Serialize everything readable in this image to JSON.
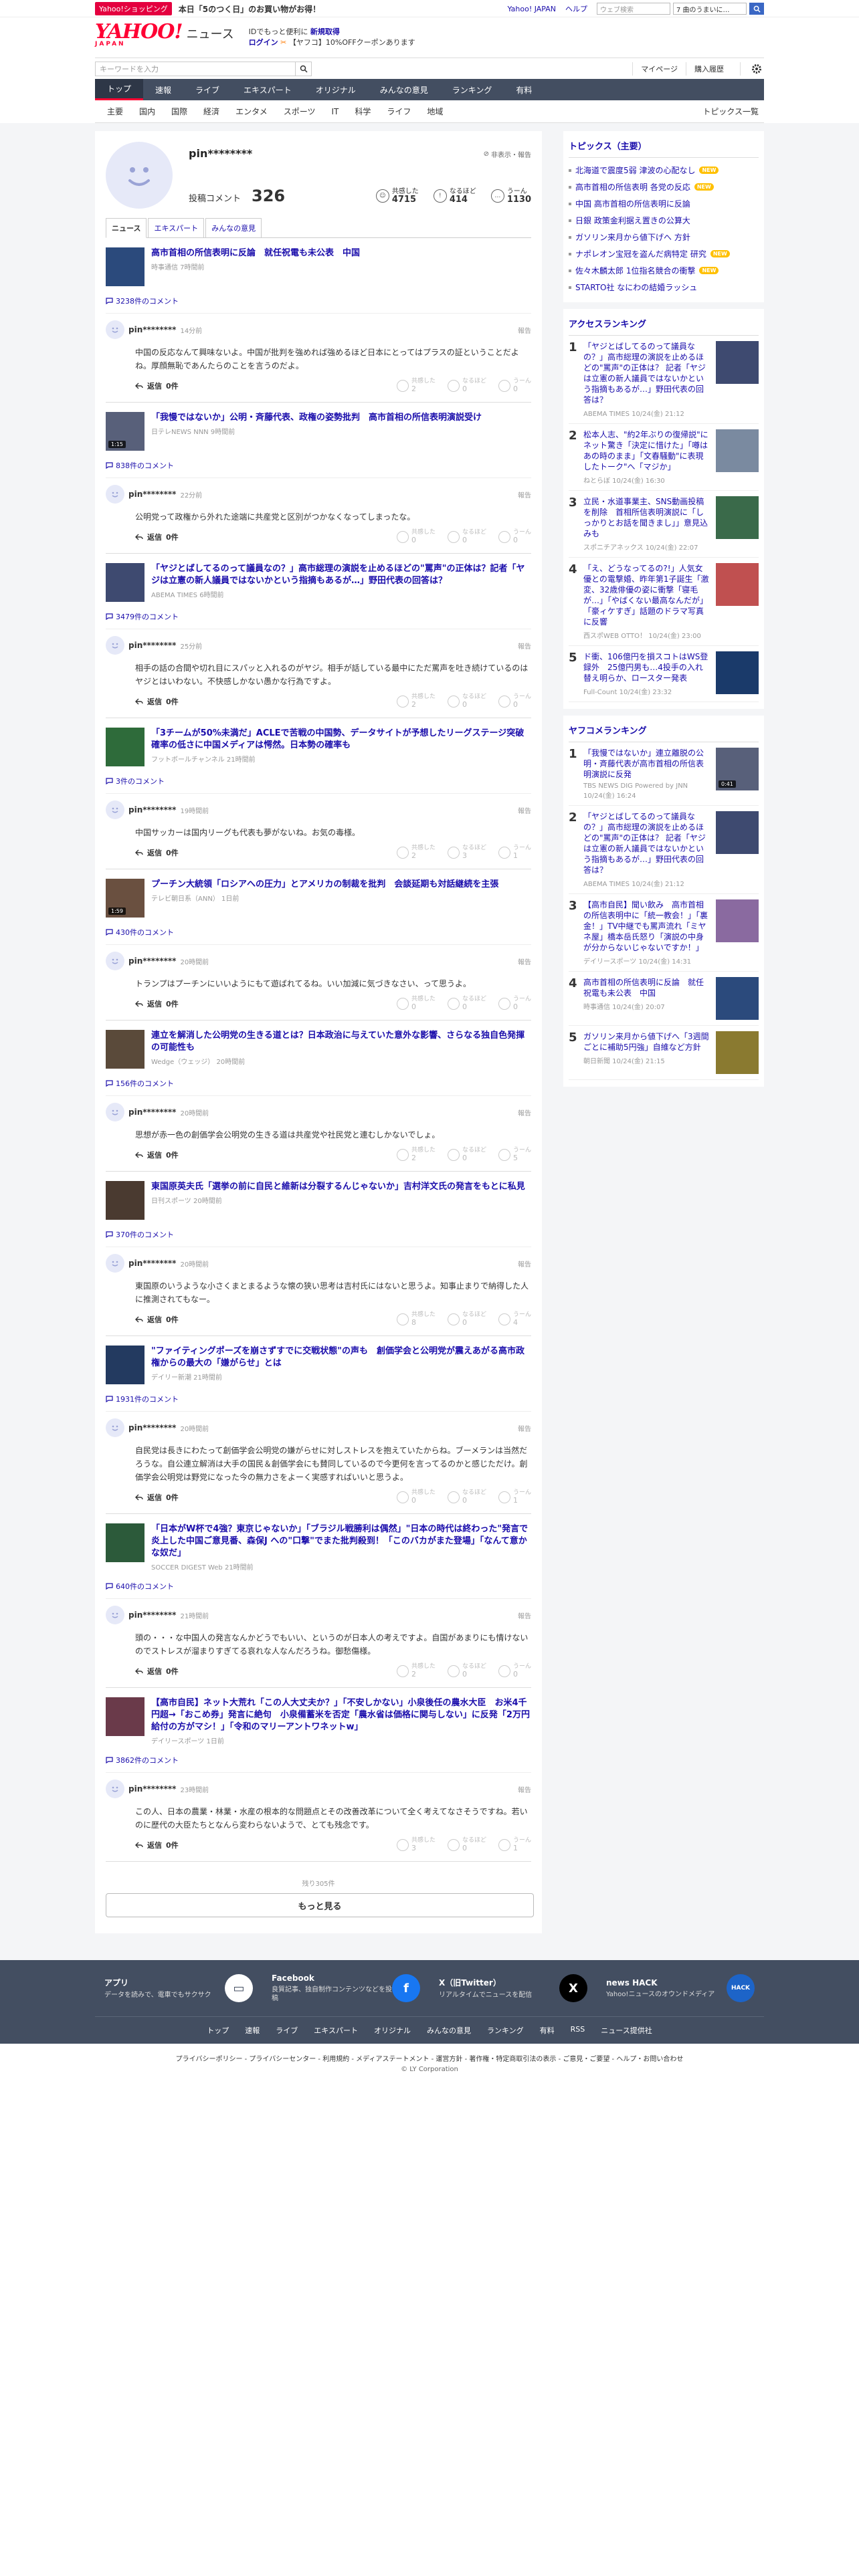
{
  "promo": {
    "tag": "Yahoo!ショッピング",
    "text": "本日「5のつく日」のお買い物がお得！",
    "links": [
      "Yahoo! JAPAN",
      "ヘルプ"
    ],
    "search_placeholder": "ウェブ検索",
    "search_value": "7 曲のうまいに…"
  },
  "header": {
    "logo": "YAHOO!",
    "logo_sub": "JAPAN",
    "section": "ニュース",
    "pr_line1": "IDでもっと便利に",
    "pr_line1_link": "新規取得",
    "pr_login": "ログイン",
    "pr_line2_text": "【ヤフコ】10%OFFクーポンあります"
  },
  "search": {
    "placeholder": "キーワードを入力",
    "mypage": "マイページ",
    "purchased": "購入履歴"
  },
  "main_nav": [
    "トップ",
    "速報",
    "ライブ",
    "エキスパート",
    "オリジナル",
    "みんなの意見",
    "ランキング",
    "有料"
  ],
  "sub_nav": [
    "主要",
    "国内",
    "国際",
    "経済",
    "エンタメ",
    "スポーツ",
    "IT",
    "科学",
    "ライフ",
    "地域"
  ],
  "sub_nav_right": "トピックス一覧",
  "profile": {
    "username": "pin********",
    "hide_report": "非表示・報告",
    "comment_label": "投稿コメント",
    "comment_count": "326",
    "empathy_label": "共感した",
    "empathy_count": "4715",
    "naruhodo_label": "なるほど",
    "naruhodo_count": "414",
    "uun_label": "うーん",
    "uun_count": "1130"
  },
  "tabs": [
    "ニュース",
    "エキスパート",
    "みんなの意見"
  ],
  "reaction_labels": [
    "共感した",
    "なるほど",
    "うーん"
  ],
  "reply_label": "返信",
  "report_label": "報告",
  "entries": [
    {
      "title": "高市首相の所信表明に反論　就任祝電も未公表　中国",
      "source": "時事通信 7時間前",
      "comment_count": "3238件のコメント",
      "user": "pin********",
      "time": "14分前",
      "text": "中国の反応なんて興味ないよ。中国が批判を強めれば強めるほど日本にとってはプラスの証ということだよね。厚顔無恥であんたらのことを言うのだよ。",
      "replies": "0件",
      "reactions": [
        "2",
        "0",
        "0"
      ],
      "thumb_color": "#2b4a7c"
    },
    {
      "title": "「我慢ではないか」公明・斉藤代表、政権の姿勢批判　高市首相の所信表明演説受け",
      "source": "日テレNEWS NNN 9時間前",
      "comment_count": "838件のコメント",
      "user": "pin********",
      "time": "22分前",
      "text": "公明党って政権から外れた途端に共産党と区別がつかなくなってしまったな。",
      "replies": "0件",
      "reactions": [
        "0",
        "0",
        "0"
      ],
      "thumb_color": "#58607a",
      "video": "1:15"
    },
    {
      "title": "「ヤジとばしてるのって議員なの？」高市総理の演説を止めるほどの\"罵声\"の正体は？記者「ヤジは立憲の新人議員ではないかという指摘もあるが…」野田代表の回答は？",
      "source": "ABEMA TIMES 6時間前",
      "comment_count": "3479件のコメント",
      "user": "pin********",
      "time": "25分前",
      "text": "相手の話の合間や切れ目にスパッと入れるのがヤジ。相手が話している最中にただ罵声を吐き続けているのはヤジとはいわない。不快感しかない愚かな行為ですよ。",
      "replies": "0件",
      "reactions": [
        "2",
        "0",
        "0"
      ],
      "thumb_color": "#3e4a70"
    },
    {
      "title": "「3チームが50%未満だ」ACLEで苦戦の中国勢、データサイトが予想したリーグステージ突破確率の低さに中国メディアは愕然。日本勢の確率も",
      "source": "フットボールチャンネル 21時間前",
      "comment_count": "3件のコメント",
      "user": "pin********",
      "time": "19時間前",
      "text": "中国サッカーは国内リーグも代表も夢がないね。お気の毒様。",
      "replies": "0件",
      "reactions": [
        "2",
        "3",
        "1"
      ],
      "thumb_color": "#2e6b3a"
    },
    {
      "title": "プーチン大統領「ロシアへの圧力」とアメリカの制裁を批判　会談延期も対話継続を主張",
      "source": "テレビ朝日系（ANN） 1日前",
      "comment_count": "430件のコメント",
      "user": "pin********",
      "time": "20時間前",
      "text": "トランプはプーチンにいいようにもて遊ばれてるね。いい加減に気づきなさい、って思うよ。",
      "replies": "0件",
      "reactions": [
        "0",
        "0",
        "0"
      ],
      "thumb_color": "#6a5040",
      "video": "1:59"
    },
    {
      "title": "連立を解消した公明党の生きる道とは？日本政治に与えていた意外な影響、さらなる独自色発揮の可能性も",
      "source": "Wedge（ウェッジ） 20時間前",
      "comment_count": "156件のコメント",
      "user": "pin********",
      "time": "20時間前",
      "text": "思想が赤一色の創価学会公明党の生きる道は共産党や社民党と連むしかないでしょ。",
      "replies": "0件",
      "reactions": [
        "2",
        "0",
        "5"
      ],
      "thumb_color": "#5a4a3a"
    },
    {
      "title": "東国原英夫氏「選挙の前に自民と維新は分裂するんじゃないか」吉村洋文氏の発言をもとに私見",
      "source": "日刊スポーツ 20時間前",
      "comment_count": "370件のコメント",
      "user": "pin********",
      "time": "20時間前",
      "text": "東国原のいうような小さくまとまるような懐の狭い思考は吉村氏にはないと思うよ。知事止まりで納得した人に推測されてもなー。",
      "replies": "0件",
      "reactions": [
        "8",
        "0",
        "4"
      ],
      "thumb_color": "#4a3a30"
    },
    {
      "title": "\"ファイティングポーズを崩さずすでに交戦状態\"の声も　創価学会と公明党が震えあがる高市政権からの最大の「嫌がらせ」とは",
      "source": "デイリー新潮 21時間前",
      "comment_count": "1931件のコメント",
      "user": "pin********",
      "time": "20時間前",
      "text": "自民党は長きにわたって創価学会公明党の嫌がらせに対しストレスを抱えていたからね。ブーメランは当然だろうな。自公連立解消は大手の国民＆創価学会にも賛同しているので今更何を言ってるのかと感じただけ。創価学会公明党は野党になった今の無力さをよーく実感すればいいと思うよ。",
      "replies": "0件",
      "reactions": [
        "0",
        "0",
        "1"
      ],
      "thumb_color": "#233a60"
    },
    {
      "title": "「日本がW杯で4強？東京じゃないか」「ブラジル戦勝利は偶然」\"日本の時代は終わった\"発言で炎上した中国ご意見番、森保J への\"口撃\"でまた批判殺到！「このバカがまた登場」「なんて意かな奴だ」",
      "source": "SOCCER DIGEST Web 21時間前",
      "comment_count": "640件のコメント",
      "user": "pin********",
      "time": "21時間前",
      "text": "頭の・・・な中国人の発言なんかどうでもいい、というのが日本人の考えですよ。自国があまりにも情けないのでストレスが溜まりすぎてる哀れな人なんだろうね。御愁傷様。",
      "replies": "0件",
      "reactions": [
        "2",
        "0",
        "0"
      ],
      "thumb_color": "#2c5a3a"
    },
    {
      "title": "【高市自民】ネット大荒れ「この人大丈夫か？」「不安しかない」小泉後任の農水大臣　お米4千円超→「おこめ券」発言に絶句　小泉備蓄米を否定「農水省は価格に関与しない」に反発「2万円給付の方がマシ！」「令和のマリーアントワネットw」",
      "source": "デイリースポーツ 1日前",
      "comment_count": "3862件のコメント",
      "user": "pin********",
      "time": "23時間前",
      "text": "この人、日本の農業・林業・水産の根本的な問題点とその改善改革について全く考えてなさそうですね。若いのに歴代の大臣たちとなんら変わらないようで、とても残念です。",
      "replies": "0件",
      "reactions": [
        "3",
        "0",
        "1"
      ],
      "thumb_color": "#6a3a4a"
    }
  ],
  "remaining": "残り305件",
  "more_button": "もっと見る",
  "sidebar": {
    "topics_header": "トピックス（主要）",
    "topics": [
      {
        "text": "北海道で震度5弱 津波の心配なし",
        "badge": "NEW"
      },
      {
        "text": "高市首相の所信表明 各党の反応",
        "badge": "NEW"
      },
      {
        "text": "中国 高市首相の所信表明に反論",
        "badge": ""
      },
      {
        "text": "日銀 政策金利据え置きの公算大",
        "badge": ""
      },
      {
        "text": "ガソリン来月から値下げへ 方針",
        "badge": ""
      },
      {
        "text": "ナポレオン宝冠を盗んだ病特定 研究",
        "badge": "NEW"
      },
      {
        "text": "佐々木麟太郎 1位指名競合の衝撃",
        "badge": "NEW"
      },
      {
        "text": "STARTO社 なにわの結婚ラッシュ",
        "badge": ""
      }
    ],
    "access_header": "アクセスランキング",
    "access": [
      {
        "title": "「ヤジとばしてるのって議員なの？」高市総理の演説を止めるほどの\"罵声\"の正体は？ 記者「ヤジは立憲の新人議員ではないかという指摘もあるが…」野田代表の回答は？",
        "source": "ABEMA TIMES 10/24(金) 21:12",
        "color": "#3e4a70"
      },
      {
        "title": "松本人志、\"約2年ぶりの復帰説\"にネット驚き「決定に惜けた」「噂はあの時のまま」「文春騒動\"に表現したトーク\"へ「マジか」",
        "source": "ねとらぼ 10/24(金) 16:30",
        "color": "#7a8aa0"
      },
      {
        "title": "立民・水道事業主、SNS動画投稿を削除　首相所信表明演説に「しっかりとお話を聞きまし」」意見込みも",
        "source": "スポニチアネックス 10/24(金) 22:07",
        "color": "#3a6a4a"
      },
      {
        "title": "「え、どうなってるの?!」人気女優との電撃婚、昨年第1子誕生「激変、32歳俳優の姿に衝撃「寝毛が…」「やばくない最高なんだが」「豪ィケすぎ」話題のドラマ写真に反響",
        "source": "西スポWEB OTTO！ 10/24(金) 23:00",
        "color": "#c05050"
      },
      {
        "title": "ド衝、106億円を損スコトはWS登録外　25億円男も…4投手の入れ替え明らか、ロースター発表",
        "source": "Full-Count 10/24(金) 23:32",
        "color": "#1a3a6a"
      }
    ],
    "yahoo_header": "ヤフコメランキング",
    "yahoo": [
      {
        "title": "「我慢ではないか」連立離脱の公明・斉藤代表が高市首相の所信表明演説に反発",
        "source": "TBS NEWS DIG Powered by JNN 10/24(金) 16:24",
        "color": "#58607a",
        "video": "0:41"
      },
      {
        "title": "「ヤジとばしてるのって議員なの？」高市総理の演説を止めるほどの\"罵声\"の正体は？ 記者「ヤジは立憲の新人議員ではないかという指摘もあるが…」野田代表の回答は？",
        "source": "ABEMA TIMES 10/24(金) 21:12",
        "color": "#3e4a70"
      },
      {
        "title": "【高市自民】聞い飲み　高市首相の所信表明中に「統一教会！」「裏金！」TV中継でも罵声流れ「ミヤネ屋」橋本岳氏怒り「演説の中身が分からないじゃないですか！」",
        "source": "デイリースポーツ 10/24(金) 14:31",
        "color": "#8a6aa0"
      },
      {
        "title": "高市首相の所信表明に反論　就任祝電も未公表　中国",
        "source": "時事通信 10/24(金) 20:07",
        "color": "#2b4a7c"
      },
      {
        "title": "ガソリン来月から値下げへ「3週間ごとに補助5円強」自維など方針",
        "source": "朝日新聞 10/24(金) 21:15",
        "color": "#8a7a30"
      }
    ]
  },
  "footer": {
    "sns": [
      {
        "title": "アプリ",
        "desc": "データを読みで、電車でもサクサク",
        "icon": "app-icon"
      },
      {
        "title": "Facebook",
        "desc": "良質記事、独自制作コンテンツなどを投稿",
        "icon": "facebook-icon"
      },
      {
        "title": "X（旧Twitter）",
        "desc": "リアルタイムでニュースを配信",
        "icon": "x-icon"
      },
      {
        "title": "news HACK",
        "desc": "Yahoo!ニュースのオウンドメディア",
        "icon": "newshack-icon"
      }
    ],
    "links": [
      "トップ",
      "速報",
      "ライブ",
      "エキスパート",
      "オリジナル",
      "みんなの意見",
      "ランキング",
      "有料",
      "RSS",
      "ニュース提供社"
    ],
    "bottom_links": "プライバシーポリシー - プライバシーセンター - 利用規約 - メディアステートメント - 運営方針 - 著作権・特定商取引法の表示 - ご意見・ご要望 - ヘルプ・お問い合わせ",
    "copyright": "© LY Corporation"
  },
  "colors": {
    "accent": "#ff0033",
    "nav_bg": "#434e61",
    "link": "#1a0dab"
  }
}
